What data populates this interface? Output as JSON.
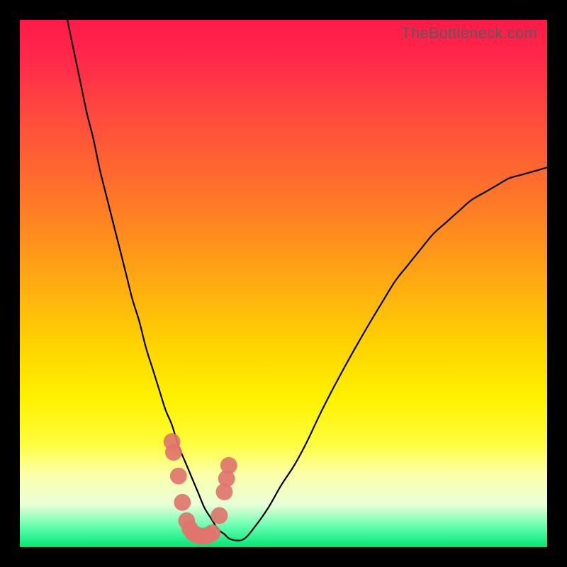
{
  "watermark": "TheBottleneck.com",
  "colors": {
    "frame": "#000000",
    "marker": "#e0756e",
    "curve": "#000000"
  },
  "chart_data": {
    "type": "line",
    "title": "",
    "xlabel": "",
    "ylabel": "",
    "xlim": [
      0,
      100
    ],
    "ylim": [
      0,
      100
    ],
    "x": [
      0,
      2,
      4,
      6,
      8,
      10,
      12,
      14,
      16,
      18,
      20,
      22,
      24,
      26,
      28,
      30,
      32,
      34,
      36,
      38,
      40,
      42,
      44,
      46,
      48,
      50,
      52,
      54,
      56,
      58,
      60,
      62,
      64,
      66,
      68,
      70,
      72,
      74,
      76,
      78,
      80,
      82,
      84,
      86,
      88,
      90,
      92,
      94,
      96,
      98,
      100
    ],
    "series": [
      {
        "name": "bottleneck-curve",
        "values": [
          100,
          94,
          88,
          82,
          77,
          71,
          66,
          61,
          56,
          51,
          46,
          42,
          37,
          33,
          29,
          25,
          22,
          18,
          15,
          12,
          9,
          6,
          4,
          2,
          1,
          0,
          0,
          1,
          3,
          6,
          9,
          13,
          18,
          23,
          28,
          33,
          38,
          43,
          48,
          52,
          56,
          60,
          63,
          66,
          69,
          71,
          73,
          75,
          76,
          77,
          78
        ]
      }
    ],
    "markers": [
      {
        "x": 32.0,
        "y": 18.5
      },
      {
        "x": 32.5,
        "y": 16.5
      },
      {
        "x": 34.0,
        "y": 12.0
      },
      {
        "x": 35.2,
        "y": 7.0
      },
      {
        "x": 36.5,
        "y": 3.5
      },
      {
        "x": 37.5,
        "y": 2.0
      },
      {
        "x": 38.5,
        "y": 1.2
      },
      {
        "x": 39.6,
        "y": 0.8
      },
      {
        "x": 40.8,
        "y": 0.6
      },
      {
        "x": 42.0,
        "y": 0.6
      },
      {
        "x": 43.2,
        "y": 0.8
      },
      {
        "x": 44.3,
        "y": 1.2
      },
      {
        "x": 46.5,
        "y": 4.5
      },
      {
        "x": 48.0,
        "y": 9.0
      },
      {
        "x": 48.7,
        "y": 11.5
      },
      {
        "x": 49.4,
        "y": 14.0
      }
    ],
    "marker_radius_pct": 1.6
  }
}
